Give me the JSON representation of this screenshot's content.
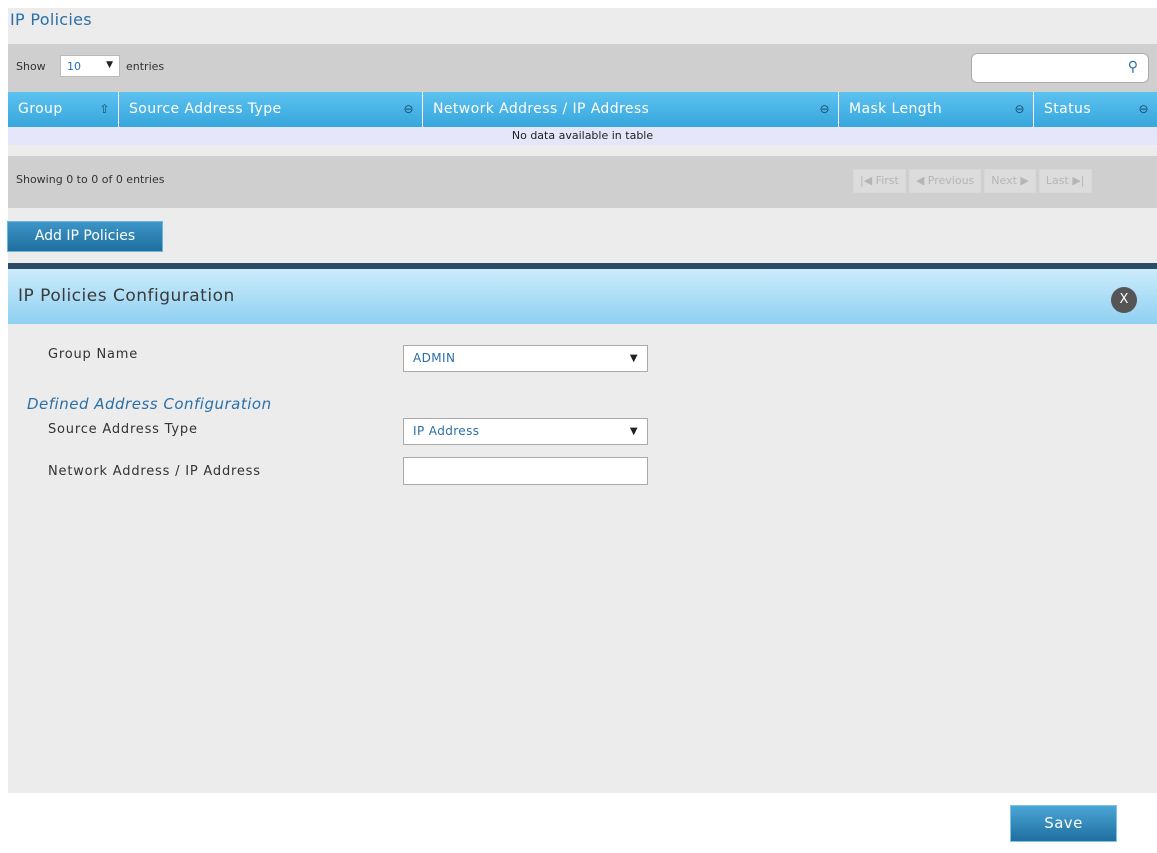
{
  "page": {
    "title": "IP Policies",
    "show_label": "Show",
    "length_value": "10",
    "entries_label": "entries",
    "search_icon": "magnifier-icon",
    "columns": [
      {
        "label": "Group",
        "sort_icon": "sort-asc-icon"
      },
      {
        "label": "Source Address Type",
        "sort_icon": "sort-both-icon"
      },
      {
        "label": "Network Address / IP Address",
        "sort_icon": "sort-both-icon"
      },
      {
        "label": "Mask Length",
        "sort_icon": "sort-both-icon"
      },
      {
        "label": "Status",
        "sort_icon": "sort-both-icon"
      }
    ],
    "empty_message": "No data available in table",
    "info_text": "Showing 0 to 0 of 0 entries",
    "pager": {
      "first": "First",
      "previous": "Previous",
      "next": "Next",
      "last": "Last"
    },
    "add_button": "Add IP Policies"
  },
  "modal": {
    "title": "IP Policies Configuration",
    "close_label": "X",
    "group_name_label": "Group Name",
    "group_name_value": "ADMIN",
    "section_title": "Defined Address Configuration",
    "source_type_label": "Source Address Type",
    "source_type_value": "IP Address",
    "network_address_label": "Network Address / IP Address",
    "network_address_value": "",
    "save_button": "Save"
  },
  "colors": {
    "accent_blue": "#2a6fa8",
    "header_blue": "#37a6dc",
    "button_blue": "#1f6f9e",
    "panel_gray": "#ececec"
  }
}
